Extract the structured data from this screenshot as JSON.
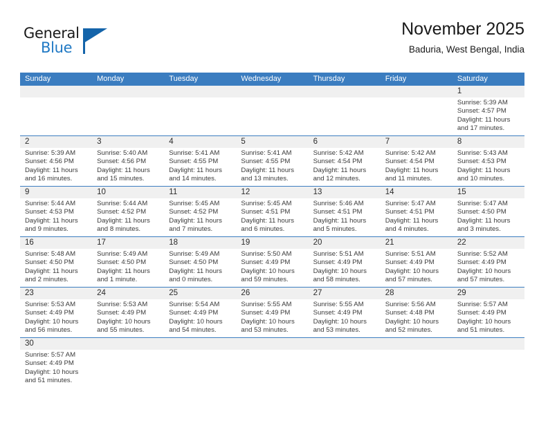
{
  "brand": {
    "name_top": "General",
    "name_bottom": "Blue",
    "flag_icon": "blue-triangle-flag",
    "color_text": "#1a1a1a",
    "color_blue": "#2079c4"
  },
  "header": {
    "title": "November 2025",
    "subtitle": "Baduria, West Bengal, India"
  },
  "theme": {
    "header_blue": "#3b7dc0",
    "day_band_gray": "#f0f0f0",
    "border_blue": "#3b7dc0"
  },
  "weekdays": [
    "Sunday",
    "Monday",
    "Tuesday",
    "Wednesday",
    "Thursday",
    "Friday",
    "Saturday"
  ],
  "weeks": [
    [
      {
        "day": "",
        "lines": [
          "",
          "",
          "",
          ""
        ],
        "empty": true
      },
      {
        "day": "",
        "lines": [
          "",
          "",
          "",
          ""
        ],
        "empty": true
      },
      {
        "day": "",
        "lines": [
          "",
          "",
          "",
          ""
        ],
        "empty": true
      },
      {
        "day": "",
        "lines": [
          "",
          "",
          "",
          ""
        ],
        "empty": true
      },
      {
        "day": "",
        "lines": [
          "",
          "",
          "",
          ""
        ],
        "empty": true
      },
      {
        "day": "",
        "lines": [
          "",
          "",
          "",
          ""
        ],
        "empty": true
      },
      {
        "day": "1",
        "lines": [
          "Sunrise: 5:39 AM",
          "Sunset: 4:57 PM",
          "Daylight: 11 hours",
          "and 17 minutes."
        ]
      }
    ],
    [
      {
        "day": "2",
        "lines": [
          "Sunrise: 5:39 AM",
          "Sunset: 4:56 PM",
          "Daylight: 11 hours",
          "and 16 minutes."
        ]
      },
      {
        "day": "3",
        "lines": [
          "Sunrise: 5:40 AM",
          "Sunset: 4:56 PM",
          "Daylight: 11 hours",
          "and 15 minutes."
        ]
      },
      {
        "day": "4",
        "lines": [
          "Sunrise: 5:41 AM",
          "Sunset: 4:55 PM",
          "Daylight: 11 hours",
          "and 14 minutes."
        ]
      },
      {
        "day": "5",
        "lines": [
          "Sunrise: 5:41 AM",
          "Sunset: 4:55 PM",
          "Daylight: 11 hours",
          "and 13 minutes."
        ]
      },
      {
        "day": "6",
        "lines": [
          "Sunrise: 5:42 AM",
          "Sunset: 4:54 PM",
          "Daylight: 11 hours",
          "and 12 minutes."
        ]
      },
      {
        "day": "7",
        "lines": [
          "Sunrise: 5:42 AM",
          "Sunset: 4:54 PM",
          "Daylight: 11 hours",
          "and 11 minutes."
        ]
      },
      {
        "day": "8",
        "lines": [
          "Sunrise: 5:43 AM",
          "Sunset: 4:53 PM",
          "Daylight: 11 hours",
          "and 10 minutes."
        ]
      }
    ],
    [
      {
        "day": "9",
        "lines": [
          "Sunrise: 5:44 AM",
          "Sunset: 4:53 PM",
          "Daylight: 11 hours",
          "and 9 minutes."
        ]
      },
      {
        "day": "10",
        "lines": [
          "Sunrise: 5:44 AM",
          "Sunset: 4:52 PM",
          "Daylight: 11 hours",
          "and 8 minutes."
        ]
      },
      {
        "day": "11",
        "lines": [
          "Sunrise: 5:45 AM",
          "Sunset: 4:52 PM",
          "Daylight: 11 hours",
          "and 7 minutes."
        ]
      },
      {
        "day": "12",
        "lines": [
          "Sunrise: 5:45 AM",
          "Sunset: 4:51 PM",
          "Daylight: 11 hours",
          "and 6 minutes."
        ]
      },
      {
        "day": "13",
        "lines": [
          "Sunrise: 5:46 AM",
          "Sunset: 4:51 PM",
          "Daylight: 11 hours",
          "and 5 minutes."
        ]
      },
      {
        "day": "14",
        "lines": [
          "Sunrise: 5:47 AM",
          "Sunset: 4:51 PM",
          "Daylight: 11 hours",
          "and 4 minutes."
        ]
      },
      {
        "day": "15",
        "lines": [
          "Sunrise: 5:47 AM",
          "Sunset: 4:50 PM",
          "Daylight: 11 hours",
          "and 3 minutes."
        ]
      }
    ],
    [
      {
        "day": "16",
        "lines": [
          "Sunrise: 5:48 AM",
          "Sunset: 4:50 PM",
          "Daylight: 11 hours",
          "and 2 minutes."
        ]
      },
      {
        "day": "17",
        "lines": [
          "Sunrise: 5:49 AM",
          "Sunset: 4:50 PM",
          "Daylight: 11 hours",
          "and 1 minute."
        ]
      },
      {
        "day": "18",
        "lines": [
          "Sunrise: 5:49 AM",
          "Sunset: 4:50 PM",
          "Daylight: 11 hours",
          "and 0 minutes."
        ]
      },
      {
        "day": "19",
        "lines": [
          "Sunrise: 5:50 AM",
          "Sunset: 4:49 PM",
          "Daylight: 10 hours",
          "and 59 minutes."
        ]
      },
      {
        "day": "20",
        "lines": [
          "Sunrise: 5:51 AM",
          "Sunset: 4:49 PM",
          "Daylight: 10 hours",
          "and 58 minutes."
        ]
      },
      {
        "day": "21",
        "lines": [
          "Sunrise: 5:51 AM",
          "Sunset: 4:49 PM",
          "Daylight: 10 hours",
          "and 57 minutes."
        ]
      },
      {
        "day": "22",
        "lines": [
          "Sunrise: 5:52 AM",
          "Sunset: 4:49 PM",
          "Daylight: 10 hours",
          "and 57 minutes."
        ]
      }
    ],
    [
      {
        "day": "23",
        "lines": [
          "Sunrise: 5:53 AM",
          "Sunset: 4:49 PM",
          "Daylight: 10 hours",
          "and 56 minutes."
        ]
      },
      {
        "day": "24",
        "lines": [
          "Sunrise: 5:53 AM",
          "Sunset: 4:49 PM",
          "Daylight: 10 hours",
          "and 55 minutes."
        ]
      },
      {
        "day": "25",
        "lines": [
          "Sunrise: 5:54 AM",
          "Sunset: 4:49 PM",
          "Daylight: 10 hours",
          "and 54 minutes."
        ]
      },
      {
        "day": "26",
        "lines": [
          "Sunrise: 5:55 AM",
          "Sunset: 4:49 PM",
          "Daylight: 10 hours",
          "and 53 minutes."
        ]
      },
      {
        "day": "27",
        "lines": [
          "Sunrise: 5:55 AM",
          "Sunset: 4:49 PM",
          "Daylight: 10 hours",
          "and 53 minutes."
        ]
      },
      {
        "day": "28",
        "lines": [
          "Sunrise: 5:56 AM",
          "Sunset: 4:48 PM",
          "Daylight: 10 hours",
          "and 52 minutes."
        ]
      },
      {
        "day": "29",
        "lines": [
          "Sunrise: 5:57 AM",
          "Sunset: 4:49 PM",
          "Daylight: 10 hours",
          "and 51 minutes."
        ]
      }
    ],
    [
      {
        "day": "30",
        "lines": [
          "Sunrise: 5:57 AM",
          "Sunset: 4:49 PM",
          "Daylight: 10 hours",
          "and 51 minutes."
        ]
      },
      {
        "day": "",
        "lines": [
          "",
          "",
          "",
          ""
        ],
        "empty": true
      },
      {
        "day": "",
        "lines": [
          "",
          "",
          "",
          ""
        ],
        "empty": true
      },
      {
        "day": "",
        "lines": [
          "",
          "",
          "",
          ""
        ],
        "empty": true
      },
      {
        "day": "",
        "lines": [
          "",
          "",
          "",
          ""
        ],
        "empty": true
      },
      {
        "day": "",
        "lines": [
          "",
          "",
          "",
          ""
        ],
        "empty": true
      },
      {
        "day": "",
        "lines": [
          "",
          "",
          "",
          ""
        ],
        "empty": true
      }
    ]
  ]
}
